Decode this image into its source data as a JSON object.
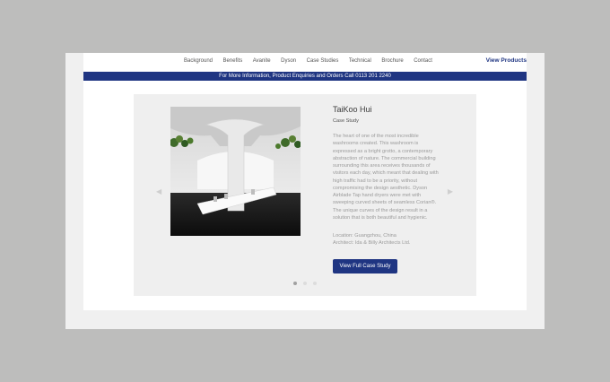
{
  "nav": {
    "links": [
      "Background",
      "Benefits",
      "Avanite",
      "Dyson",
      "Case Studies",
      "Technical",
      "Brochure",
      "Contact"
    ],
    "cta": "View Products"
  },
  "banner": {
    "text": "For More Information, Product Enquiries and Orders Call 0113 201 2240"
  },
  "case_study": {
    "title": "TaiKoo Hui",
    "subtitle": "Case Study",
    "description": "The heart of one of the most incredible washrooms created. This washroom is expressed as a bright grotto, a contemporary abstraction of nature. The commercial building surrounding this area receives thousands of visitors each day, which meant that dealing with high traffic had to be a priority, without compromising the design aesthetic. Dyson Airblade Tap hand dryers were met with sweeping curved sheets of seamless Corian®. The unique curves of the design result in a solution that is both beautiful and hygienic.",
    "location": "Location: Guangzhou, China",
    "architect": "Architect: Ida & Billy Architects Ltd.",
    "button_label": "View Full Case Study"
  },
  "carousel": {
    "total_slides": 3,
    "active_slide": 1,
    "prev_icon": "chevron-left-icon",
    "next_icon": "chevron-right-icon"
  },
  "colors": {
    "accent": "#1f3582",
    "background": "#bdbdbc",
    "card": "#efefef"
  }
}
